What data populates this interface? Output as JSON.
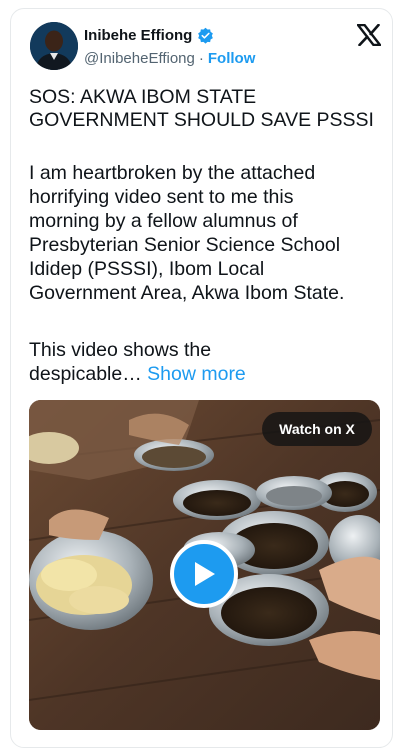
{
  "author": {
    "name": "Inibehe Effiong",
    "handle": "@InibeheEffiong",
    "separator": "·",
    "follow_label": "Follow"
  },
  "icons": {
    "verified": "verified-badge-icon",
    "platform": "x-logo-icon",
    "play": "play-icon"
  },
  "tweet": {
    "title": "SOS: AKWA IBOM STATE\nGOVERNMENT SHOULD SAVE PSSSI",
    "paragraph1": "I am heartbroken by the attached\nhorrifying video sent to me this\nmorning by a fellow alumnus of\nPresbyterian Senior Science School\nIdidep (PSSSI), Ibom Local\nGovernment Area, Akwa Ibom State.",
    "paragraph2": "This video shows the\ndespicable…",
    "show_more_label": "Show more"
  },
  "media": {
    "watch_label": "Watch on X"
  },
  "colors": {
    "accent": "#1d9bf0",
    "text": "#0f1419",
    "secondary": "#536471"
  }
}
